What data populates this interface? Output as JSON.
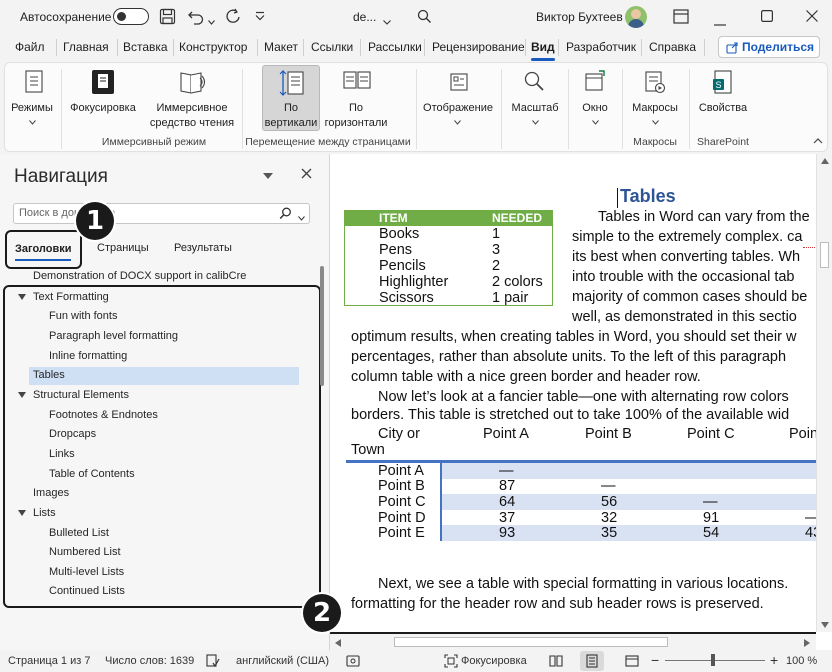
{
  "titlebar": {
    "autosave_label": "Автосохранение",
    "autosave_state": "Откл.",
    "doc_name": "de...",
    "user_name": "Виктор Бухтеев"
  },
  "ribbon_tabs": [
    {
      "label": "Файл"
    },
    {
      "label": "Главная"
    },
    {
      "label": "Вставка"
    },
    {
      "label": "Конструктор"
    },
    {
      "label": "Макет"
    },
    {
      "label": "Ссылки"
    },
    {
      "label": "Рассылки"
    },
    {
      "label": "Рецензирование"
    },
    {
      "label": "Вид"
    },
    {
      "label": "Разработчик"
    },
    {
      "label": "Справка"
    }
  ],
  "share_label": "Поделиться",
  "ribbon": {
    "modes": "Режимы",
    "focus": "Фокусировка",
    "immersive_1": "Иммерсивное",
    "immersive_2": "средство чтения",
    "vertical_1": "По",
    "vertical_2": "вертикали",
    "horizontal_1": "По",
    "horizontal_2": "горизонтали",
    "display": "Отображение",
    "zoom": "Масштаб",
    "window": "Окно",
    "macros": "Макросы",
    "properties": "Свойства",
    "group_immersive": "Иммерсивный режим",
    "group_pagemove": "Перемещение между страницами",
    "group_macros": "Макросы",
    "group_sharepoint": "SharePoint"
  },
  "nav": {
    "title": "Навигация",
    "search_placeholder": "Поиск в документе",
    "tabs": [
      "Заголовки",
      "Страницы",
      "Результаты"
    ],
    "items": [
      {
        "label": "Demonstration of DOCX support in calibCre"
      },
      {
        "label": "Text Formatting"
      },
      {
        "label": "Fun with fonts"
      },
      {
        "label": "Paragraph level formatting"
      },
      {
        "label": "Inline formatting"
      },
      {
        "label": "Tables"
      },
      {
        "label": "Structural Elements"
      },
      {
        "label": "Footnotes & Endnotes"
      },
      {
        "label": "Dropcaps"
      },
      {
        "label": "Links"
      },
      {
        "label": "Table of Contents"
      },
      {
        "label": "Images"
      },
      {
        "label": "Lists"
      },
      {
        "label": "Bulleted List"
      },
      {
        "label": "Numbered List"
      },
      {
        "label": "Multi-level Lists"
      },
      {
        "label": "Continued Lists"
      }
    ]
  },
  "badges": [
    "1",
    "2"
  ],
  "doc": {
    "heading": "Tables",
    "t1_header": [
      "ITEM",
      "NEEDED"
    ],
    "t1_rows": [
      [
        "Books",
        "1"
      ],
      [
        "Pens",
        "3"
      ],
      [
        "Pencils",
        "2"
      ],
      [
        "Highlighter",
        "2 colors"
      ],
      [
        "Scissors",
        "1 pair"
      ]
    ],
    "side_lines": [
      "Tables in Word can vary from the",
      "simple to the extremely complex. ca",
      "its best when converting tables. Wh",
      "into trouble with the occasional tab",
      "majority of common cases should be",
      "well, as demonstrated in this sectio"
    ],
    "full_lines": [
      "optimum results, when creating tables in Word, you should set their w",
      "percentages, rather than absolute units.  To the left of this paragraph",
      "column table with a nice green border and header row."
    ],
    "para2_lines": [
      "Now let’s look at a fancier table—one with alternating row colors",
      "borders. This table is stretched out to take 100% of the available wid"
    ],
    "t2_header": [
      "City or",
      "Point A",
      "Point B",
      "Point C",
      "Poin"
    ],
    "t2_header_2": "Town",
    "t2_rows": [
      [
        "Point A",
        "—",
        "",
        "",
        ""
      ],
      [
        "Point B",
        "87",
        "—",
        "",
        ""
      ],
      [
        "Point C",
        "64",
        "56",
        "—",
        ""
      ],
      [
        "Point D",
        "37",
        "32",
        "91",
        "—"
      ],
      [
        "Point E",
        "93",
        "35",
        "54",
        "43"
      ]
    ],
    "para3_lines": [
      "Next, we see a table with special formatting in various locations.",
      "formatting for the header row and sub header rows is preserved."
    ]
  },
  "status": {
    "page": "Страница 1 из 7",
    "words": "Число слов: 1639",
    "lang": "английский (США)",
    "focus": "Фокусировка",
    "zoom": "100 %"
  }
}
